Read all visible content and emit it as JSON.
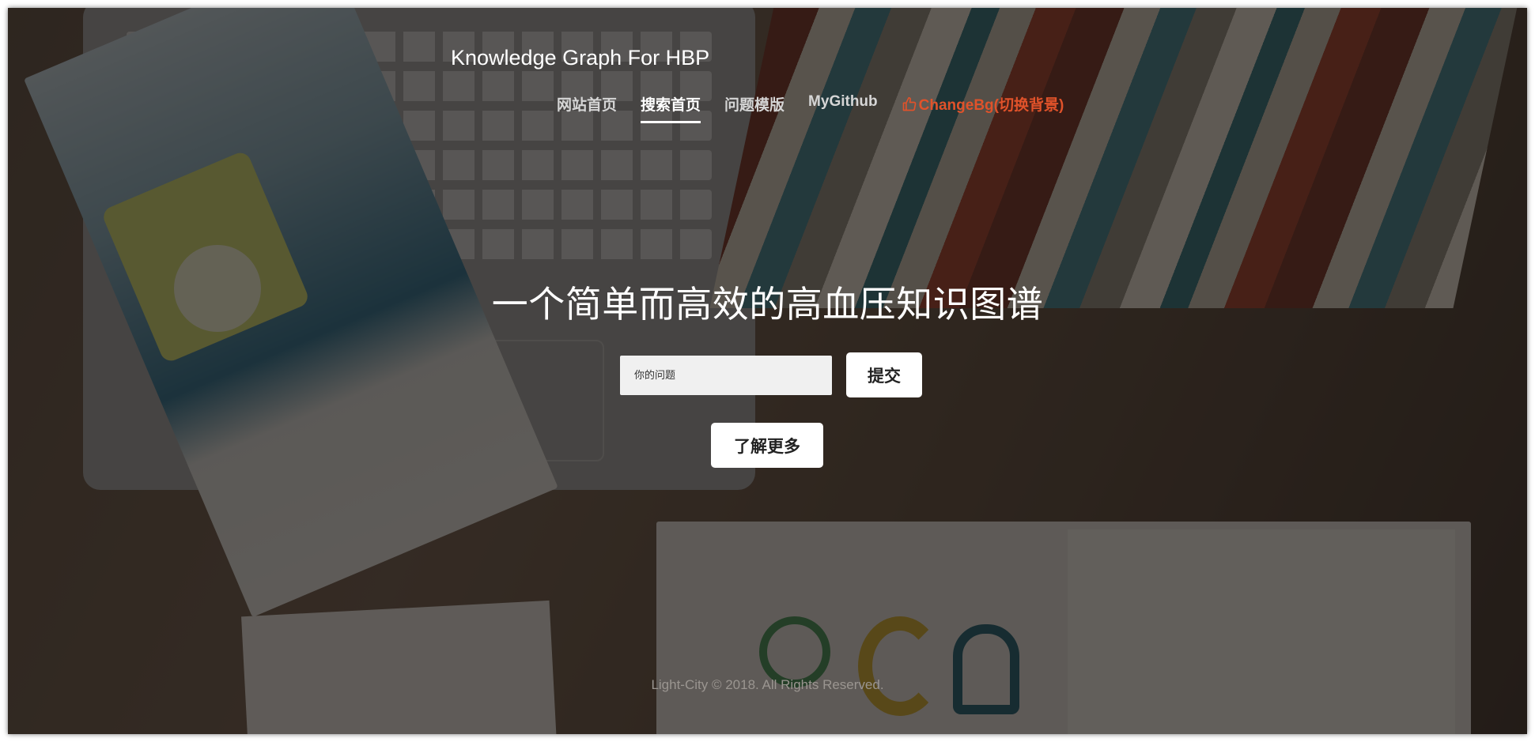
{
  "brand": {
    "title": "Knowledge Graph For HBP"
  },
  "nav": {
    "items": [
      {
        "label": "网站首页"
      },
      {
        "label": "搜索首页"
      },
      {
        "label": "问题模版"
      },
      {
        "label": "MyGithub"
      },
      {
        "label": "ChangeBg(切换背景)",
        "icon": "thumbs-up-icon"
      }
    ],
    "active_index": 1,
    "accent_color": "#e0522a"
  },
  "hero": {
    "headline": "一个简单而高效的高血压知识图谱"
  },
  "search": {
    "placeholder": "你的问题",
    "value": "",
    "submit_label": "提交"
  },
  "learn_more": {
    "label": "了解更多"
  },
  "footer": {
    "text": "Light-City © 2018. All Rights Reserved."
  }
}
